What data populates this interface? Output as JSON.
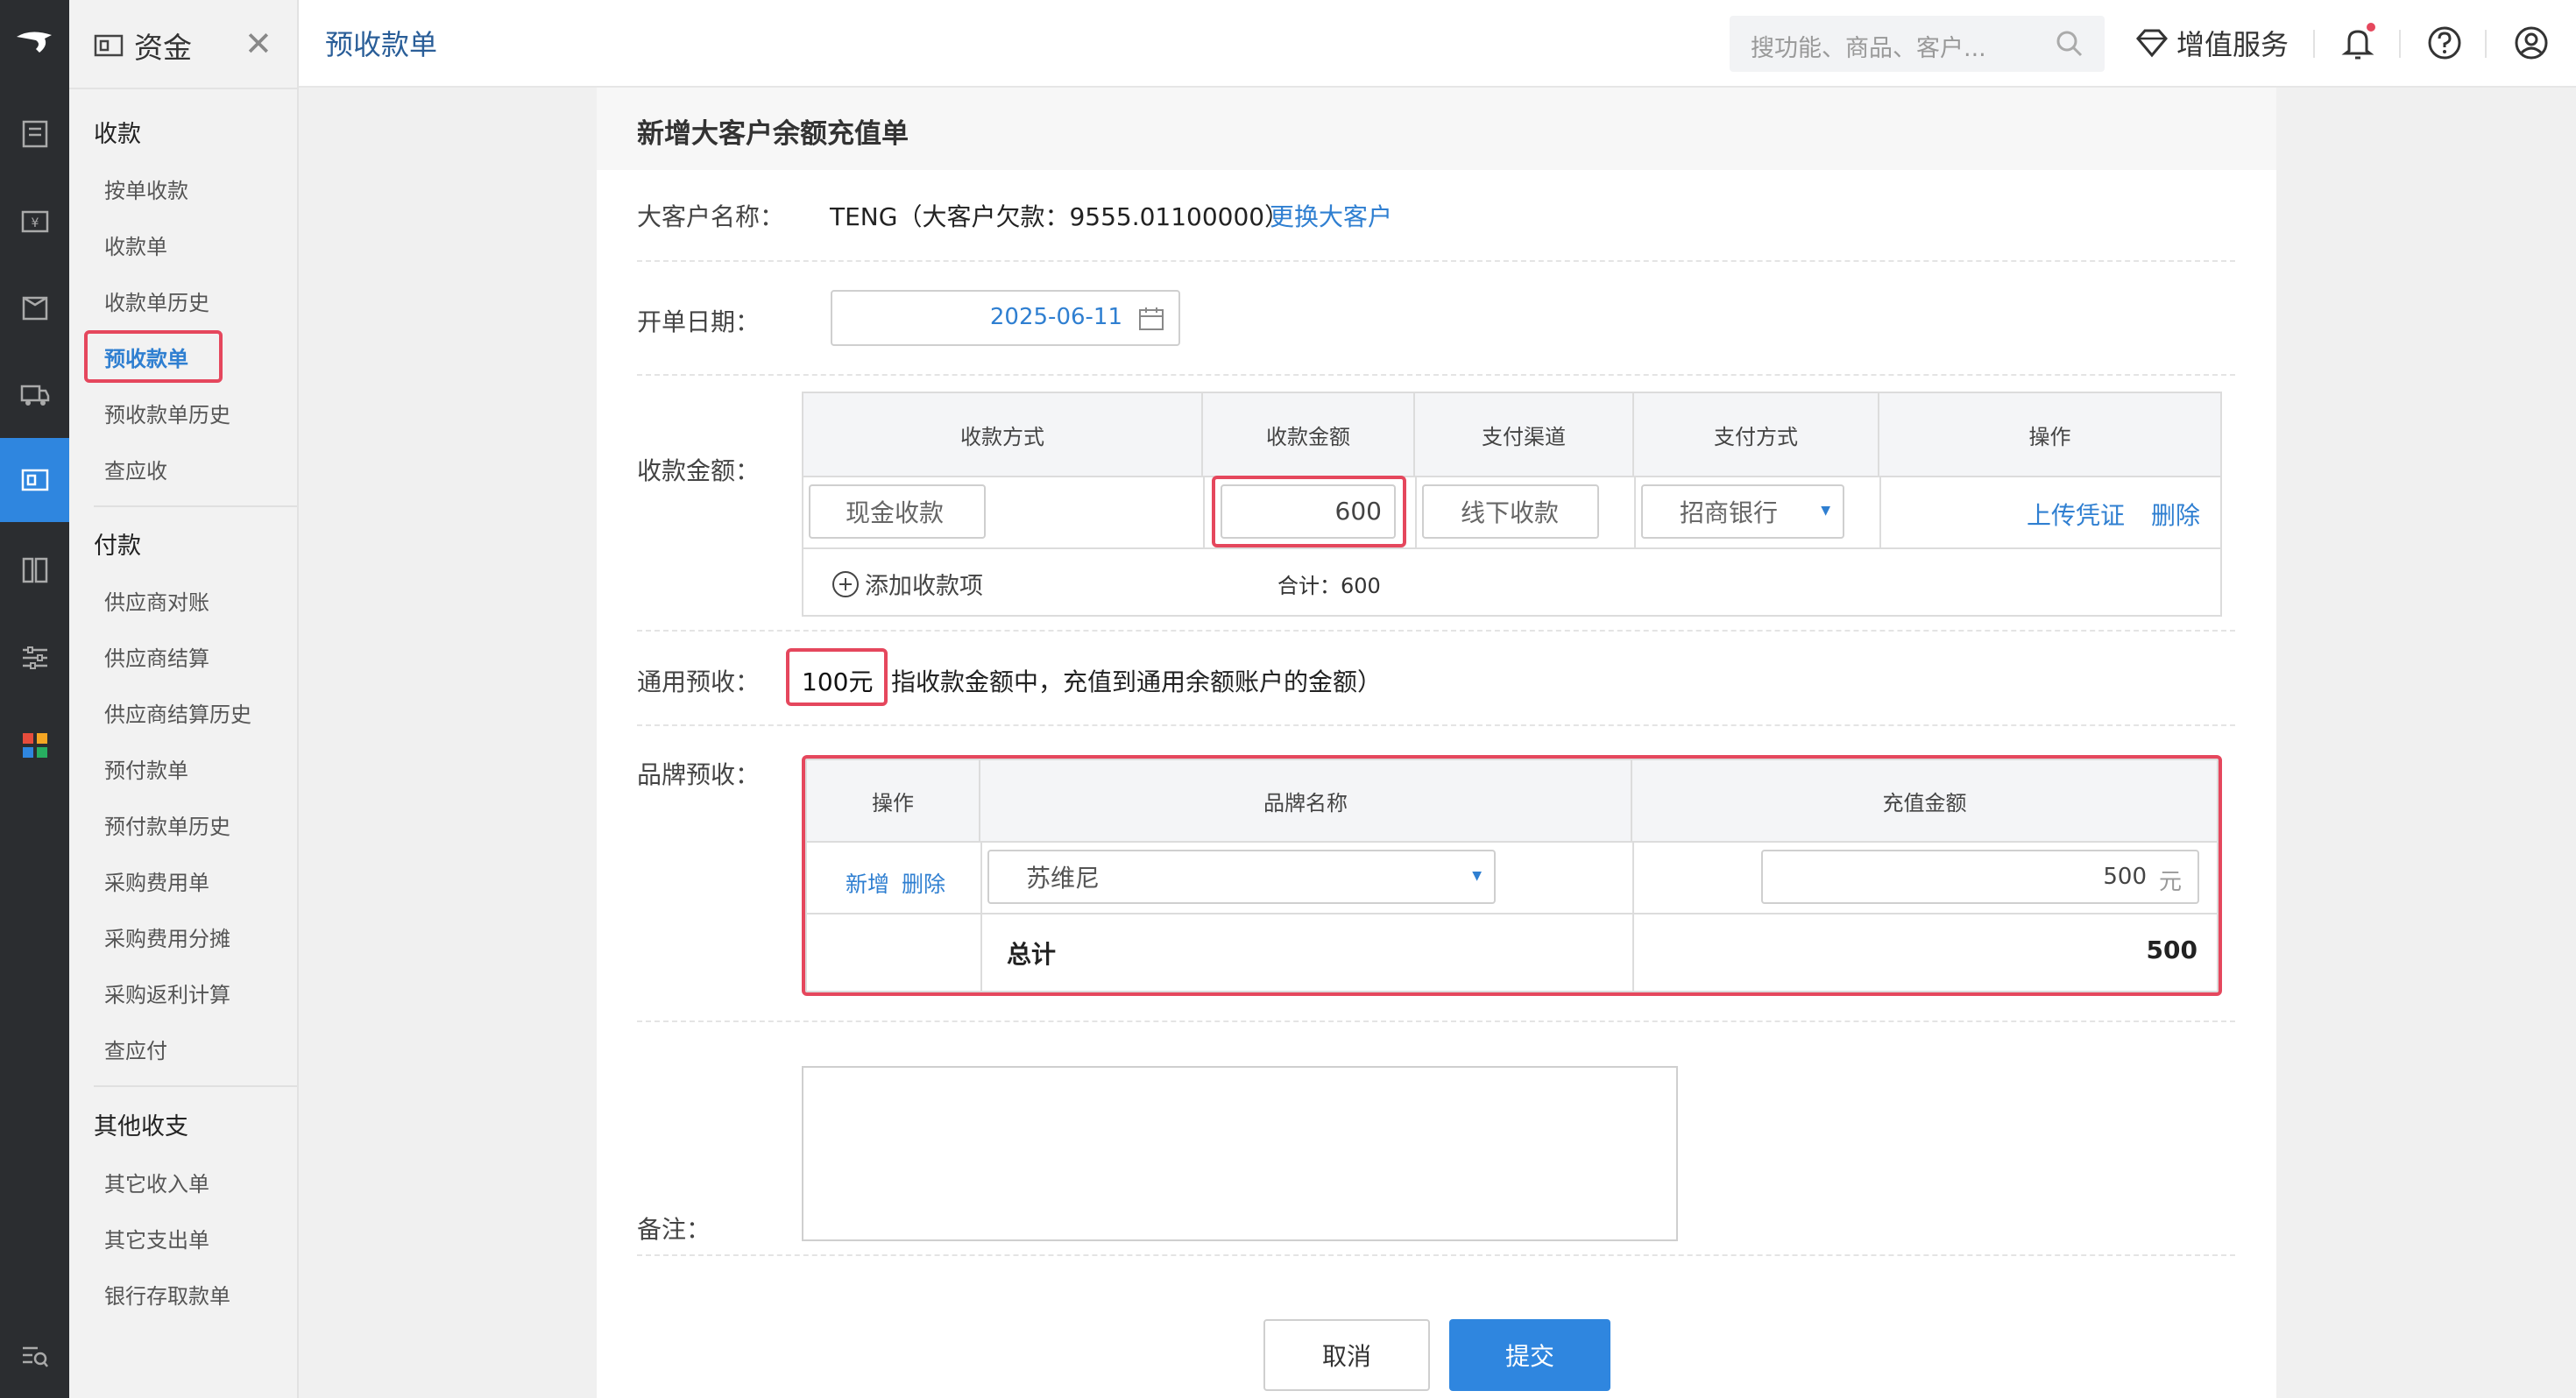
{
  "app": {
    "module_title": "资金",
    "page_tab": "预收款单"
  },
  "sidebar": {
    "groups": [
      {
        "title": "收款",
        "items": [
          "按单收款",
          "收款单",
          "收款单历史",
          "预收款单",
          "预收款单历史",
          "查应收"
        ]
      },
      {
        "title": "付款",
        "items": [
          "供应商对账",
          "供应商结算",
          "供应商结算历史",
          "预付款单",
          "预付款单历史",
          "采购费用单",
          "采购费用分摊",
          "采购返利计算",
          "查应付"
        ]
      },
      {
        "title": "其他收支",
        "items": [
          "其它收入单",
          "其它支出单",
          "银行存取款单"
        ]
      }
    ],
    "active_item": "预收款单"
  },
  "topbar": {
    "search_placeholder": "搜功能、商品、客户...",
    "vip_label": "增值服务"
  },
  "form": {
    "title": "新增大客户余额充值单",
    "customer_label": "大客户名称：",
    "customer_value": "TENG（大客户欠款：9555.01100000）",
    "change_customer_link": "更换大客户",
    "date_label": "开单日期：",
    "date_value": "2025-06-11",
    "amount_label": "收款金额：",
    "payment_table": {
      "headers": [
        "收款方式",
        "收款金额",
        "支付渠道",
        "支付方式",
        "操作"
      ],
      "row": {
        "method": "现金收款",
        "amount": "600",
        "channel": "线下收款",
        "pay_type": "招商银行",
        "upload": "上传凭证",
        "delete": "删除"
      },
      "add_item": "添加收款项",
      "total": "合计：600"
    },
    "general_label": "通用预收：",
    "general_value": "100元",
    "general_note": "指收款金额中，充值到通用余额账户的金额）",
    "brand_label": "品牌预收：",
    "brand_table": {
      "headers": [
        "操作",
        "品牌名称",
        "充值金额"
      ],
      "row": {
        "add": "新增",
        "delete": "删除",
        "brand": "苏维尼",
        "amount": "500",
        "unit": "元"
      },
      "total_label": "总计",
      "total_value": "500"
    },
    "remark_label": "备注：",
    "cancel_button": "取消",
    "submit_button": "提交"
  },
  "colors": {
    "accent": "#2f86df",
    "highlight": "#e5475d",
    "rail": "#2b2d30"
  }
}
